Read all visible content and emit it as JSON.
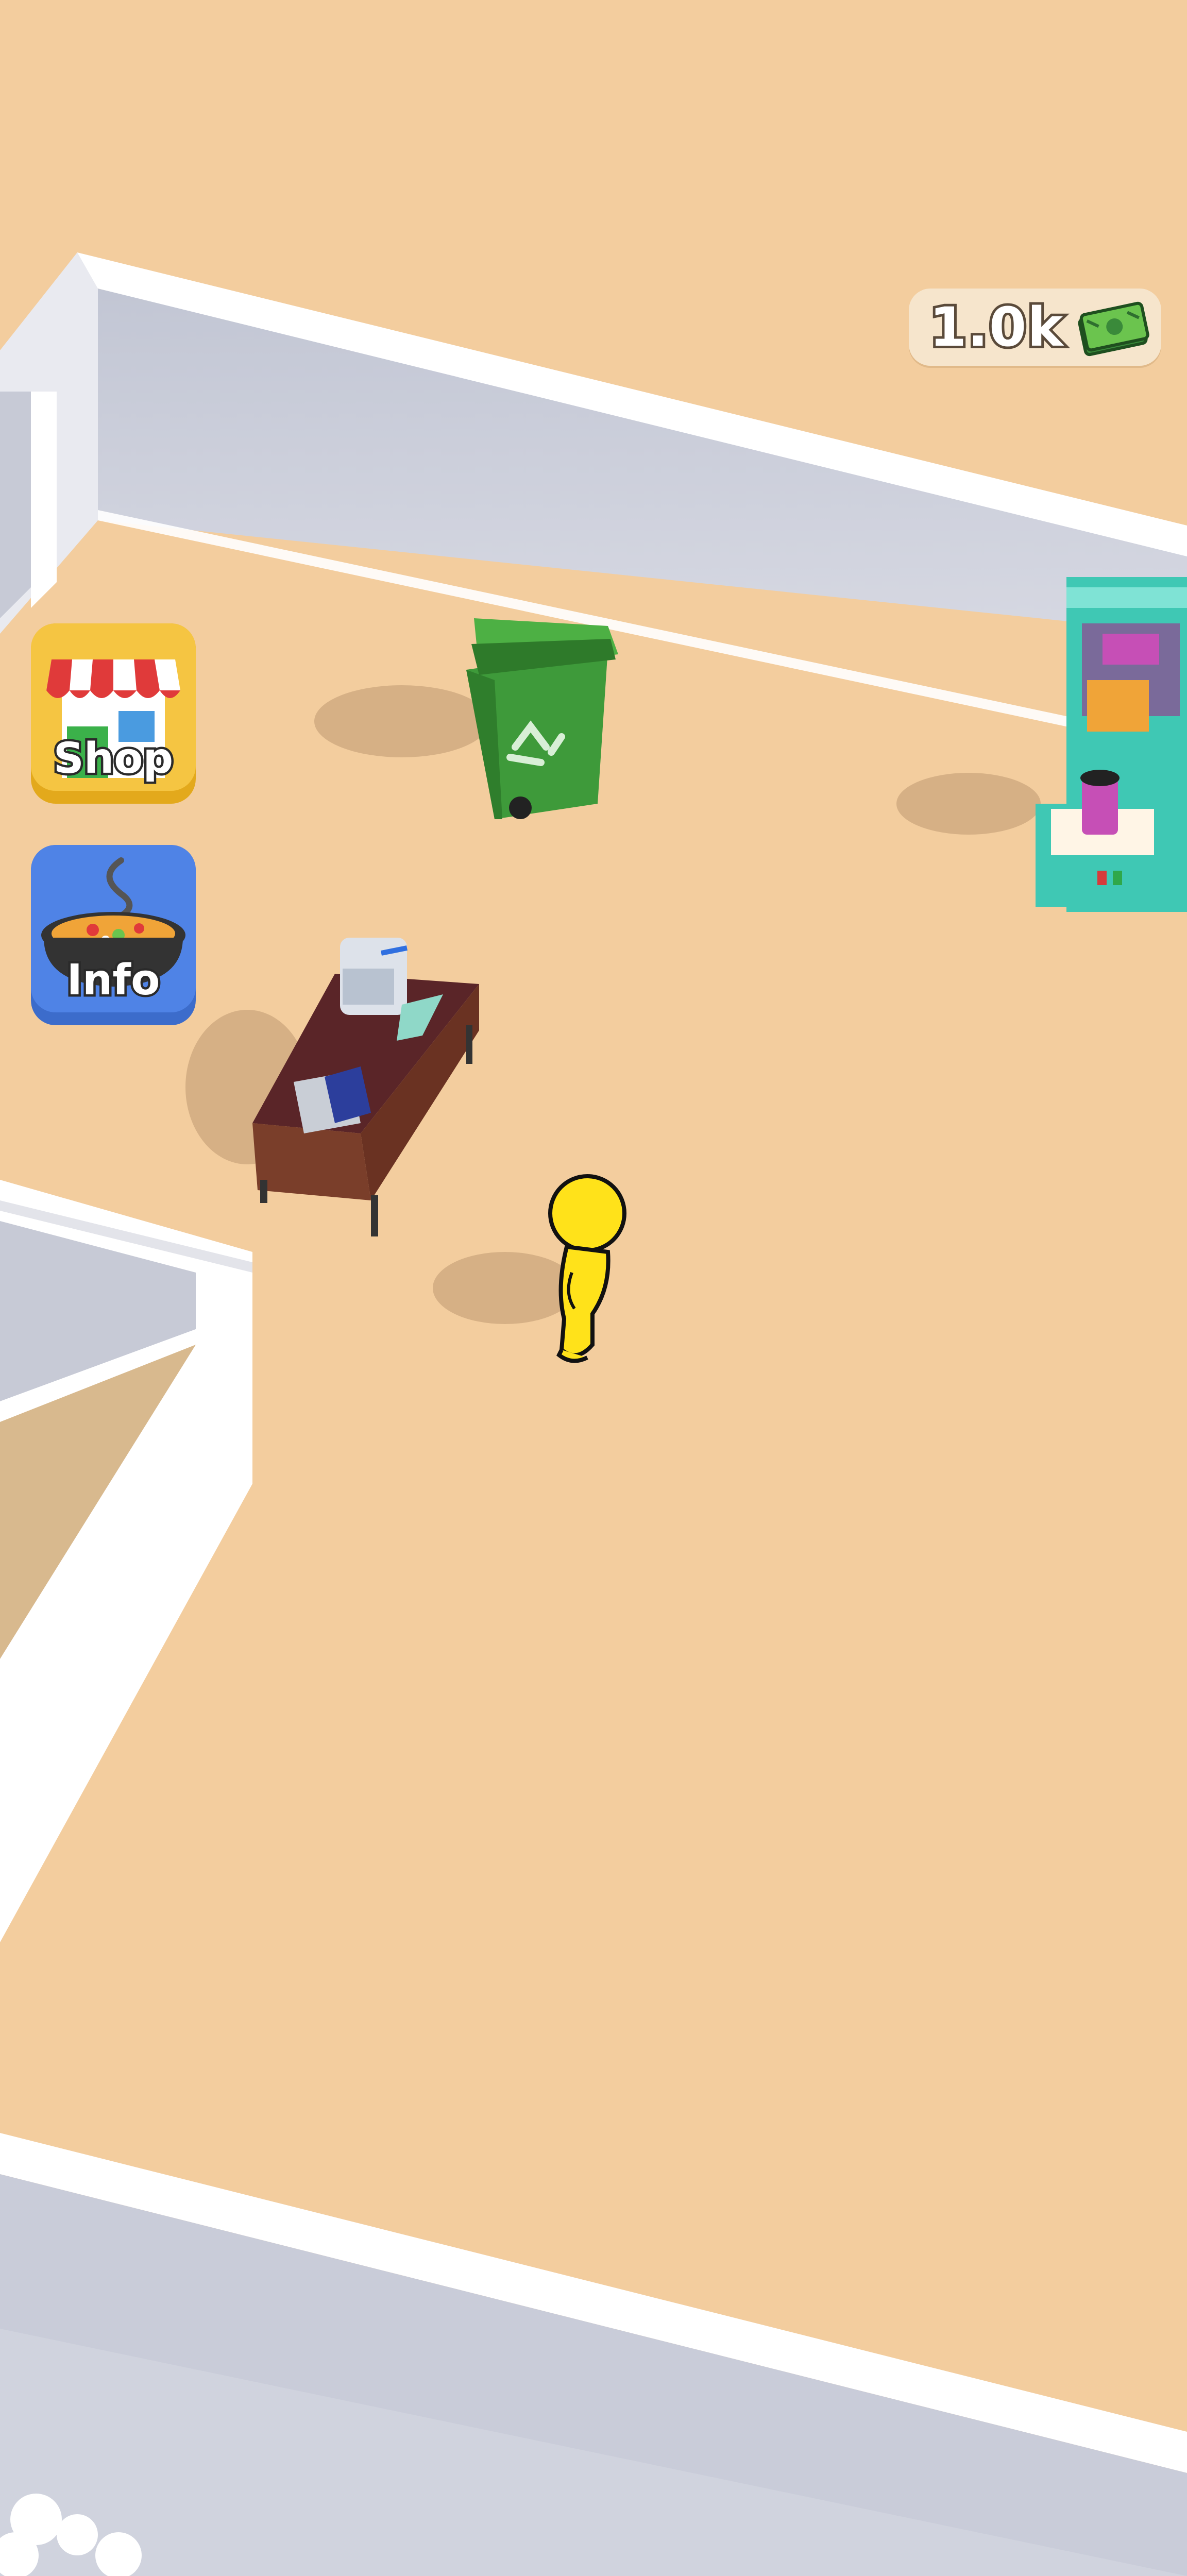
{
  "hud": {
    "money_amount": "1.0k",
    "money_icon": "cash-stack-icon"
  },
  "side_menu": {
    "shop_label": "Shop",
    "shop_icon": "storefront-icon",
    "info_label": "Info",
    "info_icon": "soup-pot-icon"
  },
  "colors": {
    "floor": "#F3CD9E",
    "wall_top": "#FFFFFF",
    "wall_face": "#C7CAD6",
    "shop_button": "#F5C542",
    "info_button": "#4F83E6",
    "player": "#FFE21A",
    "trash_bin": "#3E9A3A"
  }
}
